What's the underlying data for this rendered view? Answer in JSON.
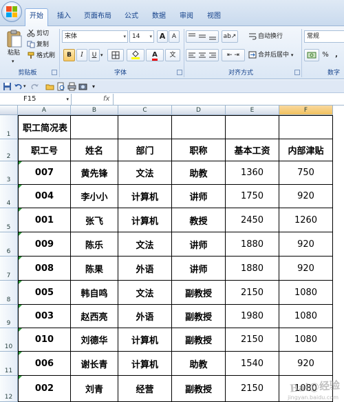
{
  "ribbon": {
    "tabs": [
      {
        "label": "开始",
        "active": true
      },
      {
        "label": "插入",
        "active": false
      },
      {
        "label": "页面布局",
        "active": false
      },
      {
        "label": "公式",
        "active": false
      },
      {
        "label": "数据",
        "active": false
      },
      {
        "label": "审阅",
        "active": false
      },
      {
        "label": "视图",
        "active": false
      }
    ],
    "clipboard": {
      "paste_label": "粘贴",
      "cut_label": "剪切",
      "copy_label": "复制",
      "format_painter_label": "格式刷",
      "group_label": "剪贴板"
    },
    "font": {
      "font_name": "宋体",
      "font_size": "14",
      "bold": "B",
      "italic": "I",
      "underline": "U",
      "grow": "A",
      "shrink": "A",
      "wen": "文",
      "group_label": "字体"
    },
    "alignment": {
      "wrap_text_label": "自动换行",
      "merge_center_label": "合并后居中",
      "group_label": "对齐方式"
    },
    "number": {
      "format_value": "常规",
      "percent": "%",
      "comma": ",",
      "group_label": "数字"
    }
  },
  "formula_bar": {
    "name_box": "F15",
    "fx_label": "fx",
    "formula": ""
  },
  "columns": [
    "A",
    "B",
    "C",
    "D",
    "E",
    "F"
  ],
  "selected_column": "F",
  "rows": [
    {
      "num": "1",
      "cells": [
        "职工简况表",
        "",
        "",
        "",
        "",
        ""
      ]
    },
    {
      "num": "2",
      "cells": [
        "职工号",
        "姓名",
        "部门",
        "职称",
        "基本工资",
        "内部津贴"
      ]
    },
    {
      "num": "3",
      "cells": [
        "007",
        "黄先锋",
        "文法",
        "助教",
        "1360",
        "750"
      ]
    },
    {
      "num": "4",
      "cells": [
        "004",
        "李小小",
        "计算机",
        "讲师",
        "1750",
        "920"
      ]
    },
    {
      "num": "5",
      "cells": [
        "001",
        "张飞",
        "计算机",
        "教授",
        "2450",
        "1260"
      ]
    },
    {
      "num": "6",
      "cells": [
        "009",
        "陈乐",
        "文法",
        "讲师",
        "1880",
        "920"
      ]
    },
    {
      "num": "7",
      "cells": [
        "008",
        "陈果",
        "外语",
        "讲师",
        "1880",
        "920"
      ]
    },
    {
      "num": "8",
      "cells": [
        "005",
        "韩自鸣",
        "文法",
        "副教授",
        "2150",
        "1080"
      ]
    },
    {
      "num": "9",
      "cells": [
        "003",
        "赵西亮",
        "外语",
        "副教授",
        "1980",
        "1080"
      ]
    },
    {
      "num": "10",
      "cells": [
        "010",
        "刘德华",
        "计算机",
        "副教授",
        "2150",
        "1080"
      ]
    },
    {
      "num": "11",
      "cells": [
        "006",
        "谢长青",
        "计算机",
        "助教",
        "1540",
        "920"
      ]
    },
    {
      "num": "12",
      "cells": [
        "002",
        "刘青",
        "经营",
        "副教授",
        "2150",
        "1080"
      ]
    }
  ],
  "watermark": {
    "logo": "Bai@经验",
    "text": "jingyan.baidu.com"
  },
  "colors": {
    "accent": "#15428b",
    "selected_header": "#f1c15f",
    "green_marker": "#2f9b3a"
  }
}
